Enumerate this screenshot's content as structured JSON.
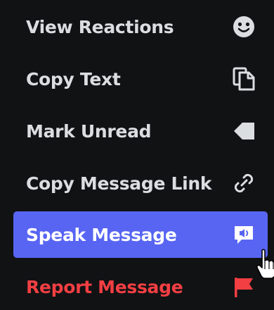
{
  "menu": {
    "items": [
      {
        "label": "View Reactions",
        "icon": "smiley-face-icon"
      },
      {
        "label": "Copy Text",
        "icon": "copy-icon"
      },
      {
        "label": "Mark Unread",
        "icon": "tag-icon"
      },
      {
        "label": "Copy Message Link",
        "icon": "link-icon"
      },
      {
        "label": "Speak Message",
        "icon": "speaker-bubble-icon"
      },
      {
        "label": "Report Message",
        "icon": "flag-icon"
      }
    ]
  },
  "colors": {
    "background": "#111214",
    "text": "#dbdee1",
    "highlight": "#5865f2",
    "danger": "#f23f43"
  }
}
